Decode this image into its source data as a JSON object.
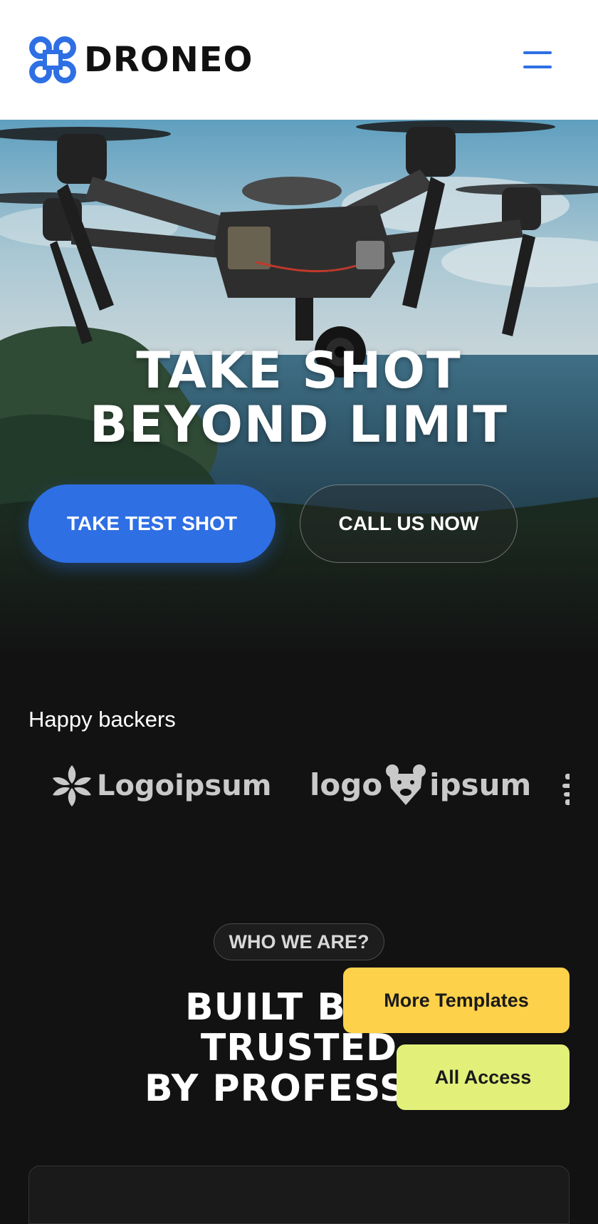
{
  "header": {
    "brand": "DRONEO",
    "brand_icon": "drone-logo-icon",
    "menu_icon": "hamburger-menu-icon",
    "accent_color": "#2f6fe4"
  },
  "hero": {
    "title_line1": "TAKE SHOT",
    "title_line2": "BEYOND LIMIT",
    "primary_button": "TAKE TEST SHOT",
    "secondary_button": "CALL US NOW"
  },
  "backers": {
    "label": "Happy backers",
    "logos": [
      {
        "name": "Logoipsum",
        "icon": "flower-logo-icon"
      },
      {
        "name_left": "logo",
        "name_right": "ipsum",
        "icon": "bear-logo-icon"
      }
    ]
  },
  "about": {
    "badge": "WHO WE ARE?",
    "title_line1": "BUILT BY P",
    "title_line2": "TRUSTED",
    "title_line3": "BY PROFESSIO"
  },
  "floating": {
    "more_templates": "More Templates",
    "all_access": "All Access",
    "more_templates_color": "#fdd14a",
    "all_access_color": "#e2f07a"
  }
}
